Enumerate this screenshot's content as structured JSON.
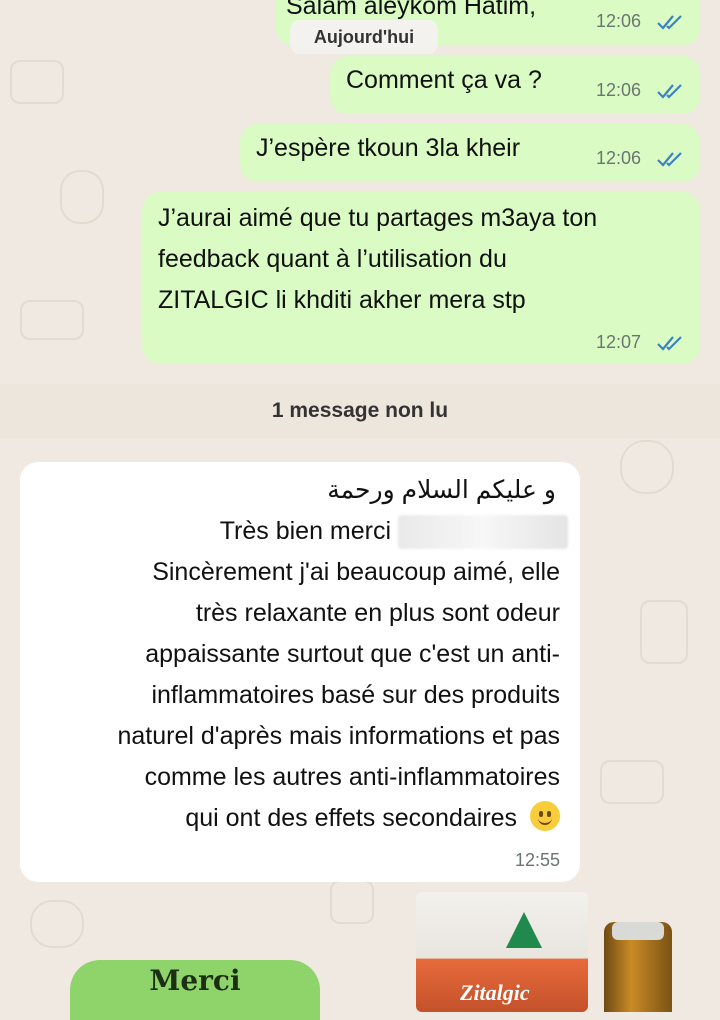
{
  "date_chip": "Aujourd'hui",
  "unread_divider": "1 message non lu",
  "outgoing": [
    {
      "text": "Salam aleykom Hatim,",
      "time": "12:06"
    },
    {
      "text": "Comment ça va ?",
      "time": "12:06"
    },
    {
      "text": "J’espère tkoun 3la kheir",
      "time": "12:06"
    },
    {
      "lines": [
        "J’aurai aimé que tu partages m3aya ton",
        "feedback quant à l’utilisation du",
        "ZITALGIC li khditi akher mera stp"
      ],
      "time": "12:07"
    }
  ],
  "incoming": {
    "line_arabic": "و عليكم السلام ورحمة",
    "line_greeting": "Très bien merci",
    "lines": [
      "Sincèrement j'ai beaucoup aimé, elle",
      "très relaxante en plus sont odeur",
      "appaissante surtout que c'est un anti-",
      "inflammatoires basé sur des produits",
      "naturel d'après mais informations et pas",
      "comme les autres anti-inflammatoires",
      "qui ont des effets secondaires"
    ],
    "emoji": "slightly-smiling-face",
    "time": "12:55"
  },
  "sticker": {
    "text": "Merci"
  },
  "product": {
    "box_label": "Zitalgic"
  },
  "colors": {
    "outgoing_bubble": "#dafcc4",
    "incoming_bubble": "#ffffff",
    "read_ticks": "#3b82c4",
    "background": "#efe9e1"
  }
}
